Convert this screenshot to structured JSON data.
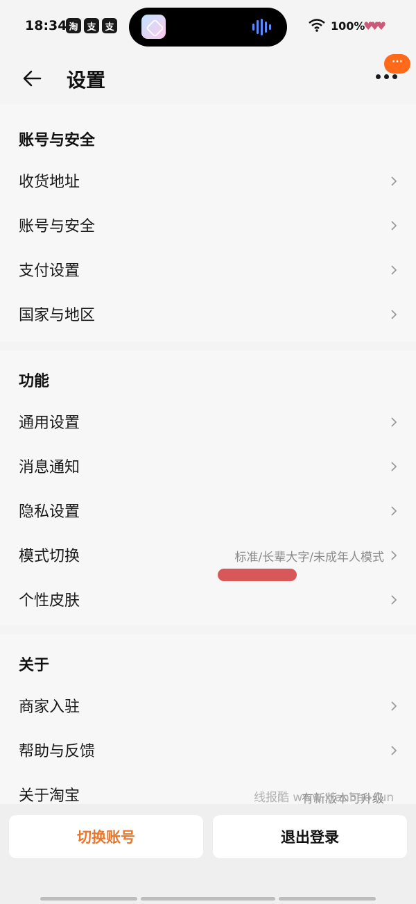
{
  "status": {
    "time": "18:34",
    "badges": [
      "淘",
      "支",
      "支"
    ],
    "battery": "100%"
  },
  "header": {
    "title": "设置",
    "notify_badge": "···"
  },
  "sections": [
    {
      "title": "账号与安全",
      "items": [
        {
          "label": "收货地址",
          "value": ""
        },
        {
          "label": "账号与安全",
          "value": ""
        },
        {
          "label": "支付设置",
          "value": ""
        },
        {
          "label": "国家与地区",
          "value": ""
        }
      ]
    },
    {
      "title": "功能",
      "items": [
        {
          "label": "通用设置",
          "value": ""
        },
        {
          "label": "消息通知",
          "value": ""
        },
        {
          "label": "隐私设置",
          "value": ""
        },
        {
          "label": "模式切换",
          "value": "标准/长辈大字/未成年人模式"
        },
        {
          "label": "个性皮肤",
          "value": ""
        }
      ]
    },
    {
      "title": "关于",
      "items": [
        {
          "label": "商家入驻",
          "value": ""
        },
        {
          "label": "帮助与反馈",
          "value": ""
        },
        {
          "label": "关于淘宝",
          "value": "有新版本可升级"
        }
      ]
    }
  ],
  "watermark": "线报酷 www.xianbao.fun",
  "buttons": {
    "switch_account": "切换账号",
    "logout": "退出登录"
  },
  "colors": {
    "accent": "#e8772e",
    "badge": "#ff6a1a",
    "mark": "#d8585a"
  }
}
